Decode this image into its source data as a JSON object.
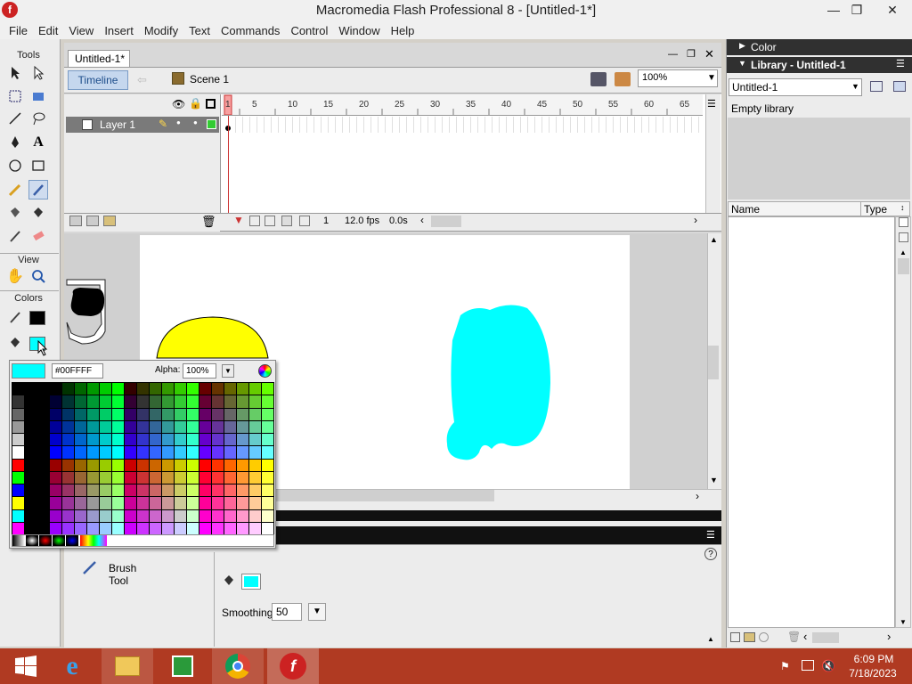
{
  "window": {
    "title": "Macromedia Flash Professional 8 - [Untitled-1*]"
  },
  "menu": [
    "File",
    "Edit",
    "View",
    "Insert",
    "Modify",
    "Text",
    "Commands",
    "Control",
    "Window",
    "Help"
  ],
  "toolbox": {
    "tools_label": "Tools",
    "view_label": "View",
    "colors_label": "Colors"
  },
  "document": {
    "tab": "Untitled-1*",
    "timeline_button": "Timeline",
    "scene": "Scene 1",
    "zoom": "100%"
  },
  "timeline": {
    "layer_name": "Layer 1",
    "ruler_ticks": [
      "1",
      "5",
      "10",
      "15",
      "20",
      "25",
      "30",
      "35",
      "40",
      "45",
      "50",
      "55",
      "60",
      "65"
    ],
    "current_frame": "1",
    "fps": "12.0 fps",
    "elapsed": "0.0s"
  },
  "color_popup": {
    "hex": "#00FFFF",
    "alpha_label": "Alpha:",
    "alpha": "100%"
  },
  "properties": {
    "tool_name_1": "Brush",
    "tool_name_2": "Tool",
    "smoothing_label": "Smoothing",
    "smoothing": "50",
    "help": "?"
  },
  "panels": {
    "color_title": "Color",
    "library_title": "Library - Untitled-1",
    "library_select": "Untitled-1",
    "empty_msg": "Empty library",
    "col_name": "Name",
    "col_type": "Type"
  },
  "taskbar": {
    "time": "6:09 PM",
    "date": "7/18/2023"
  },
  "colors": {
    "fill": "#00FFFF",
    "stroke": "#000000",
    "accent": "#7a7a7a",
    "taskbar": "#b03a22",
    "yellow": "#FFFF00"
  }
}
